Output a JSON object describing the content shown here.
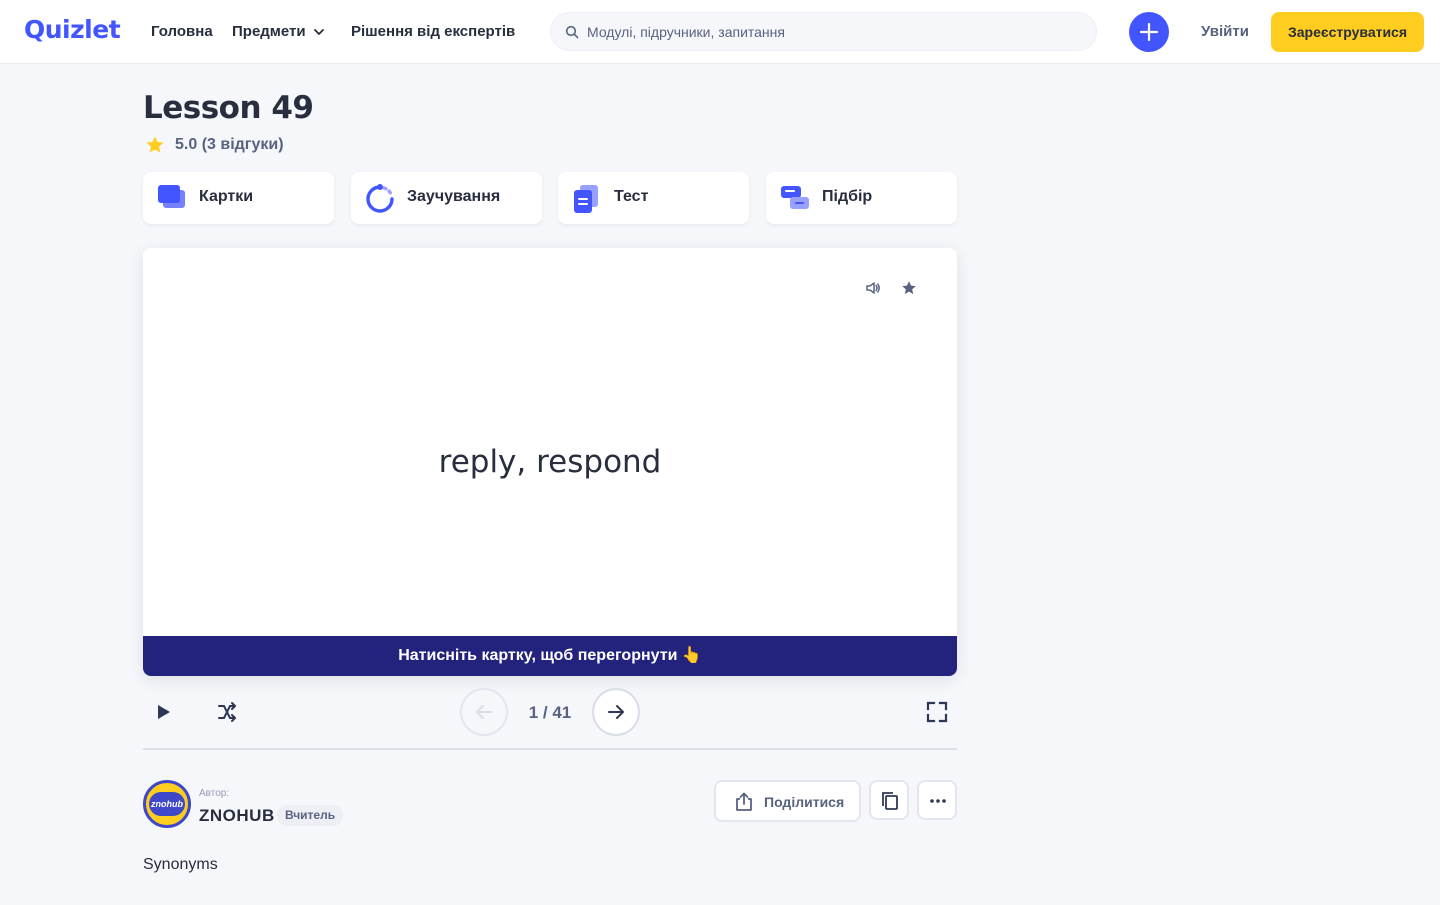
{
  "header": {
    "logo": "Quizlet",
    "nav": {
      "home": "Головна",
      "subjects": "Предмети",
      "experts": "Рішення від експертів"
    },
    "search_placeholder": "Модулі, підручники, запитання",
    "login": "Увійти",
    "signup": "Зареєструватися"
  },
  "set": {
    "title": "Lesson 49",
    "rating": "5.0 (3 відгуки)"
  },
  "modes": [
    {
      "label": "Картки",
      "icon": "cards-icon"
    },
    {
      "label": "Заучування",
      "icon": "learn-icon"
    },
    {
      "label": "Тест",
      "icon": "test-icon"
    },
    {
      "label": "Підбір",
      "icon": "match-icon"
    }
  ],
  "card": {
    "term": "reply, respond",
    "hint": "Натисніть картку, щоб перегорнути 👆"
  },
  "controls": {
    "counter": "1 / 41"
  },
  "author": {
    "label": "Автор:",
    "name": "ZNOHUB",
    "badge": "Вчитель",
    "avatar_text": "znohub"
  },
  "actions": {
    "share": "Поділитися"
  },
  "description": "Synonyms",
  "colors": {
    "brand": "#4255ff",
    "signup": "#ffcd1f",
    "hint_bar": "#23237e"
  }
}
